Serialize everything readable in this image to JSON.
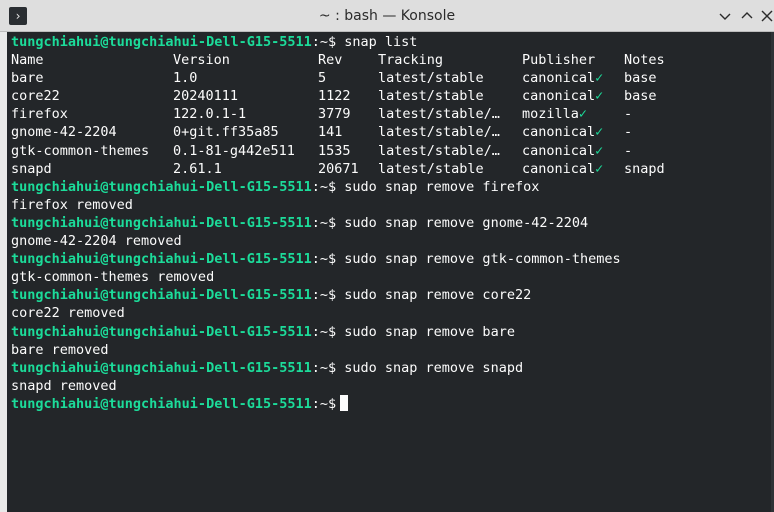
{
  "window": {
    "title": "~ : bash — Konsole",
    "app_icon_glyph": "›"
  },
  "prompt": {
    "user_host": "tungchiahui@tungchiahui-Dell-G15-5511",
    "sep": ":~$"
  },
  "snap_list": {
    "command": "snap list",
    "headers": [
      "Name",
      "Version",
      "Rev",
      "Tracking",
      "Publisher",
      "Notes"
    ],
    "rows": [
      {
        "name": "bare",
        "version": "1.0",
        "rev": "5",
        "tracking": "latest/stable",
        "publisher": "canonical",
        "check": "✓",
        "notes": "base"
      },
      {
        "name": "core22",
        "version": "20240111",
        "rev": "1122",
        "tracking": "latest/stable",
        "publisher": "canonical",
        "check": "✓",
        "notes": "base"
      },
      {
        "name": "firefox",
        "version": "122.0.1-1",
        "rev": "3779",
        "tracking": "latest/stable/…",
        "publisher": "mozilla",
        "check": "✓",
        "notes": "-"
      },
      {
        "name": "gnome-42-2204",
        "version": "0+git.ff35a85",
        "rev": "141",
        "tracking": "latest/stable/…",
        "publisher": "canonical",
        "check": "✓",
        "notes": "-"
      },
      {
        "name": "gtk-common-themes",
        "version": "0.1-81-g442e511",
        "rev": "1535",
        "tracking": "latest/stable/…",
        "publisher": "canonical",
        "check": "✓",
        "notes": "-"
      },
      {
        "name": "snapd",
        "version": "2.61.1",
        "rev": "20671",
        "tracking": "latest/stable",
        "publisher": "canonical",
        "check": "✓",
        "notes": "snapd"
      }
    ]
  },
  "history": [
    {
      "command": "sudo snap remove firefox",
      "output": "firefox removed"
    },
    {
      "command": "sudo snap remove gnome-42-2204",
      "output": "gnome-42-2204 removed"
    },
    {
      "command": "sudo snap remove gtk-common-themes",
      "output": "gtk-common-themes removed"
    },
    {
      "command": "sudo snap remove core22",
      "output": "core22 removed"
    },
    {
      "command": "sudo snap remove bare",
      "output": "bare removed"
    },
    {
      "command": "sudo snap remove snapd",
      "output": "snapd removed"
    }
  ],
  "colors": {
    "background": "#232629",
    "prompt": "#1cdc9a",
    "text": "#fcfcfc",
    "titlebar": "#dedede"
  }
}
